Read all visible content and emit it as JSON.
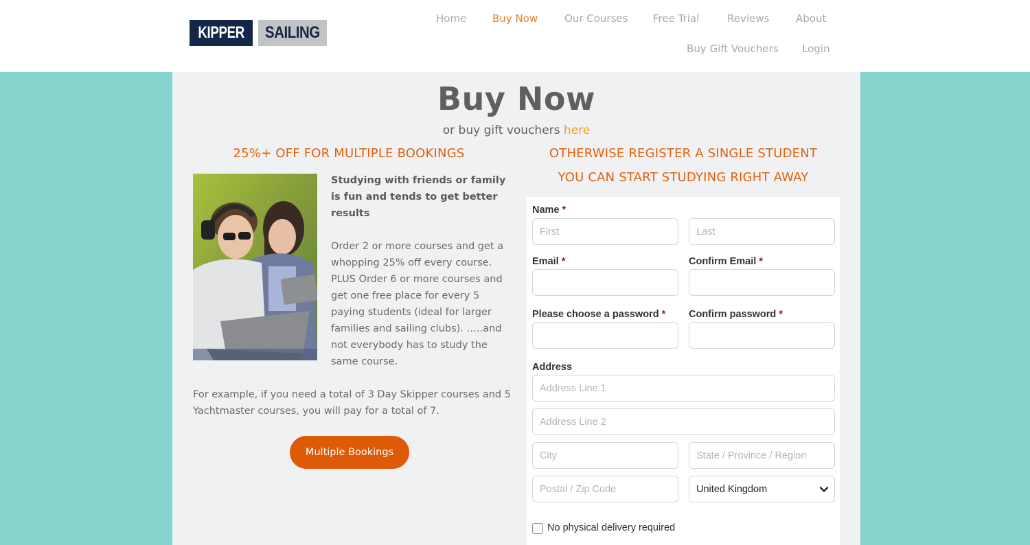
{
  "header": {
    "logo": {
      "left": "KIPPER",
      "right": "SAILING"
    },
    "nav": {
      "row1": [
        {
          "label": "Home",
          "active": false
        },
        {
          "label": "Buy Now",
          "active": true
        },
        {
          "label": "Our Courses",
          "active": false
        },
        {
          "label": "Free Trial",
          "active": false
        },
        {
          "label": "Reviews",
          "active": false
        },
        {
          "label": "About",
          "active": false
        }
      ],
      "row2": [
        {
          "label": "Buy Gift Vouchers",
          "active": false
        },
        {
          "label": "Login",
          "active": false
        }
      ]
    }
  },
  "colors": {
    "accent_orange": "#e0610f",
    "button_orange": "#df5a05",
    "link_orange": "#f39a25",
    "nav_active": "#f07b26",
    "page_background": "#84d3cd",
    "panel_background": "#f0f1f3",
    "logo_navy": "#14264a",
    "logo_grey": "#c2c3c5"
  },
  "main": {
    "title": "Buy Now",
    "subtitle_prefix": "or  buy gift vouchers ",
    "subtitle_link": "here",
    "left": {
      "heading": "25%+ OFF FOR MULTIPLE BOOKINGS",
      "image_alt": "Two students studying with a laptop and tablet",
      "lead": "Studying with friends or family is fun and tends to get better results",
      "body": "Order 2 or more courses and get a whopping 25% off every course. PLUS Order 6 or more courses and get one free place for every 5 paying students (ideal for larger families and sailing clubs). …..and not everybody has to study the same course.",
      "example": "For example, if you need a total of 3 Day Skipper courses and 5 Yachtmaster courses, you will pay for a total of 7.",
      "button_label": "Multiple Bookings"
    },
    "right": {
      "heading_line1": "OTHERWISE REGISTER A SINGLE STUDENT",
      "heading_line2": "YOU CAN START STUDYING RIGHT AWAY",
      "form": {
        "required_mark": "*",
        "name_label": "Name",
        "first_placeholder": "First",
        "last_placeholder": "Last",
        "email_label": "Email",
        "confirm_email_label": "Confirm Email",
        "password_label": "Please choose a password",
        "confirm_password_label": "Confirm password",
        "address_label": "Address",
        "address1_placeholder": "Address Line 1",
        "address2_placeholder": "Address Line 2",
        "city_placeholder": "City",
        "state_placeholder": "State / Province / Region",
        "postal_placeholder": "Postal / Zip Code",
        "country_value": "United Kingdom",
        "no_delivery_label": "No physical delivery required",
        "no_delivery_checked": false
      }
    }
  }
}
